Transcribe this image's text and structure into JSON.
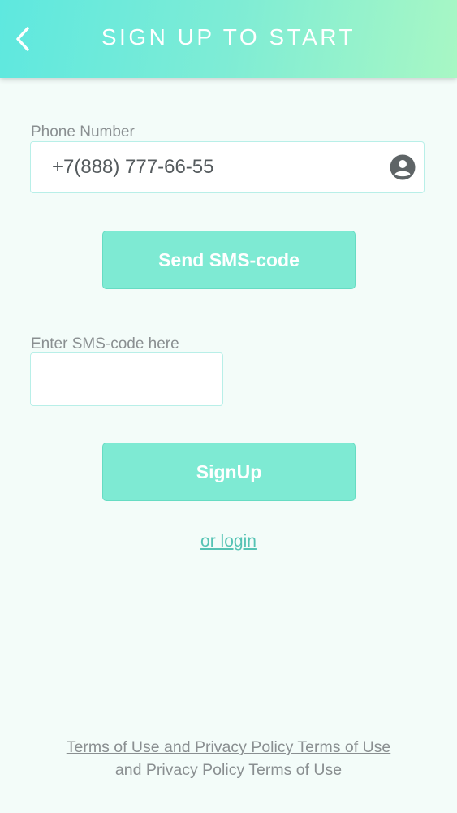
{
  "header": {
    "title": "SIGN UP TO START",
    "back_icon": "chevron-left-icon"
  },
  "phone": {
    "label": "Phone Number",
    "value": "+7(888) 777-66-55",
    "icon": "account-circle-icon"
  },
  "send_sms_button": {
    "label": "Send SMS-code"
  },
  "sms_code": {
    "label": "Enter SMS-code here",
    "value": ""
  },
  "signup_button": {
    "label": "SignUp"
  },
  "login_link": {
    "label": "or login"
  },
  "terms": {
    "line1": "Terms of Use and Privacy Policy Terms of Use ",
    "line2": "and Privacy Policy Terms of Use "
  },
  "colors": {
    "header_gradient_start": "#5ee8df",
    "header_gradient_end": "#a8f7c4",
    "button": "#7eead3",
    "link": "#55c3b4",
    "background": "#f3fcf9"
  }
}
